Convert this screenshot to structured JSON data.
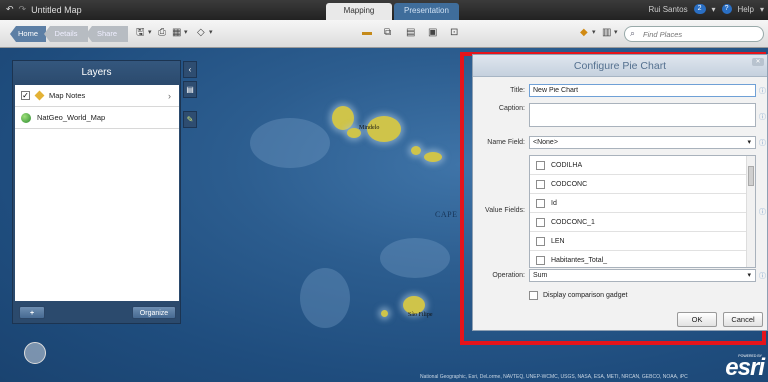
{
  "titlebar": {
    "map_title": "Untitled Map",
    "tabs": [
      "Mapping",
      "Presentation"
    ],
    "user": "Rui Santos",
    "notifications": "2",
    "help": "Help"
  },
  "toolbar": {
    "home": "Home",
    "details": "Details",
    "share": "Share",
    "find_placeholder": "Find Places"
  },
  "layers_panel": {
    "title": "Layers",
    "items": [
      {
        "label": "Map Notes",
        "checked": true
      },
      {
        "label": "NatGeo_World_Map"
      }
    ],
    "add_button": "+",
    "organize_button": "Organize"
  },
  "map": {
    "labels": [
      "Mindelo",
      "CAPE",
      "São Filipe"
    ],
    "attribution": "National Geographic, Esri, DeLorme, NAVTEQ, UNEP-WCMC, USGS, NASA, ESA, METI, NRCAN, GEBCO, NOAA, iPC",
    "powered_by": "POWERED BY",
    "logo": "esri"
  },
  "dialog": {
    "title": "Configure Pie Chart",
    "title_label": "Title:",
    "title_value": "New Pie Chart",
    "caption_label": "Caption:",
    "caption_value": "",
    "name_field_label": "Name Field:",
    "name_field_value": "<None>",
    "value_fields_label": "Value Fields:",
    "value_fields": [
      "CODILHA",
      "CODCONC",
      "Id",
      "CODCONC_1",
      "LEN",
      "Habitantes_Total_"
    ],
    "operation_label": "Operation:",
    "operation_value": "Sum",
    "comparison_label": "Display comparison gadget",
    "ok": "OK",
    "cancel": "Cancel"
  },
  "colors": {
    "highlight_frame": "#e5141b",
    "ocean": "#2c5d8f",
    "land": "#cfc44a"
  }
}
